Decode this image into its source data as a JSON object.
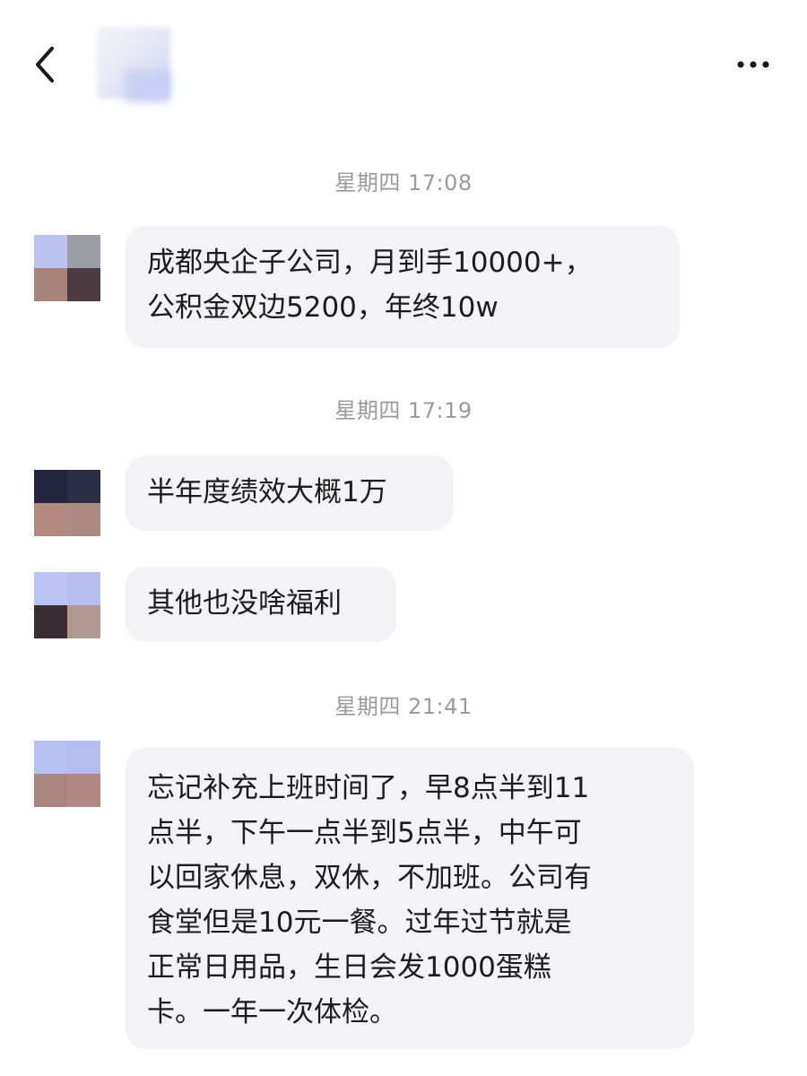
{
  "header": {
    "back_icon": "chevron-left-icon",
    "more_icon": "more-dots-icon"
  },
  "messages": [
    {
      "timestamp": "星期四 17:08",
      "text": "成都央企子公司，月到手10000+，\n公积金双边5200，年终10w"
    },
    {
      "timestamp": "星期四 17:19",
      "text": "半年度绩效大概1万"
    },
    {
      "timestamp": "",
      "text": "其他也没啥福利"
    },
    {
      "timestamp": "星期四 21:41",
      "text": "忘记补充上班时间了，早8点半到11\n点半，下午一点半到5点半，中午可\n以回家休息，双休，不加班。公司有\n食堂但是10元一餐。过年过节就是\n正常日用品，生日会发1000蛋糕\n卡。一年一次体检。"
    }
  ]
}
